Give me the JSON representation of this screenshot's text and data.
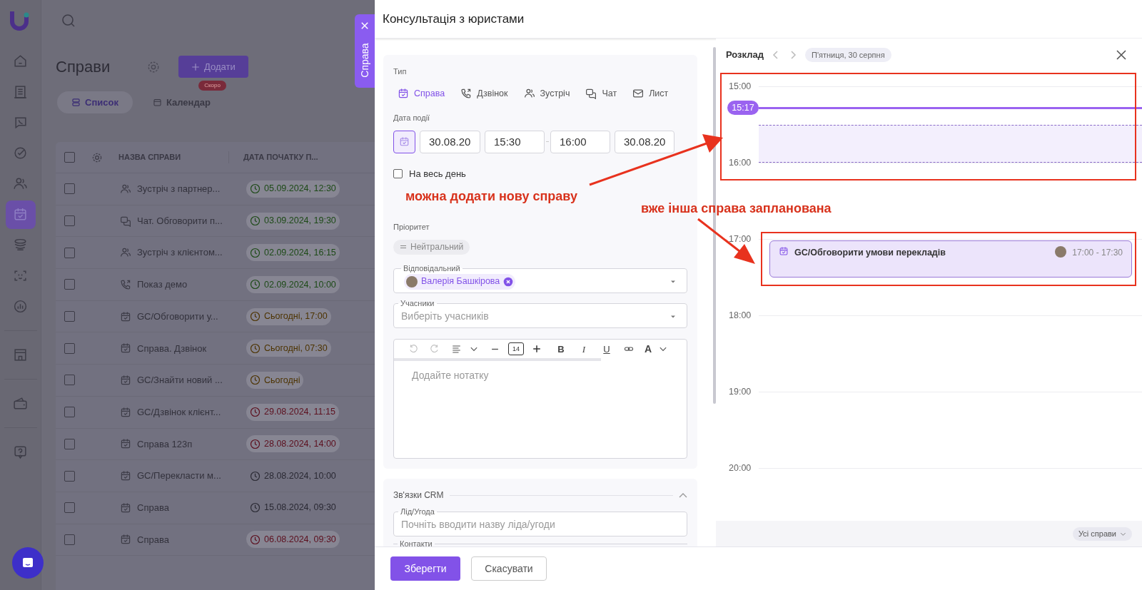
{
  "sidebar": {
    "groups": [
      [
        {
          "selected": false
        },
        {
          "selected": false
        },
        {
          "selected": false
        },
        {
          "selected": false
        },
        {
          "selected": false
        },
        {
          "selected": true
        },
        {
          "selected": false
        },
        {
          "selected": false
        },
        {
          "selected": false
        }
      ],
      [
        {
          "selected": false
        }
      ],
      [
        {
          "selected": false
        }
      ],
      [
        {
          "selected": false
        }
      ]
    ]
  },
  "page": {
    "title": "Справи",
    "add_button": "Додати",
    "view_tabs": [
      {
        "label": "Список",
        "selected": true
      },
      {
        "label": "Календар",
        "selected": false,
        "badge": "Скоро"
      }
    ]
  },
  "table": {
    "select_all": {
      "checked": false
    },
    "columns": [
      "НАЗВА СПРАВИ",
      "ДАТА ПОЧАТКУ П..."
    ],
    "rows": [
      {
        "checked": false,
        "kind": "meeting",
        "name": "Зустріч з партнер...",
        "date": "05.09.2024, 12:30",
        "color": "#1d4a17"
      },
      {
        "checked": false,
        "kind": "chat",
        "name": "Чат. Обговорити п...",
        "date": "03.09.2024, 19:30",
        "color": "#1d4a17"
      },
      {
        "checked": false,
        "kind": "meeting",
        "name": "Зустріч з клієнтом...",
        "date": "02.09.2024, 16:15",
        "color": "#1d4a17"
      },
      {
        "checked": false,
        "kind": "call",
        "name": "Показ демо",
        "date": "02.09.2024, 10:00",
        "color": "#1d4a17"
      },
      {
        "checked": false,
        "kind": "task",
        "name": "GC/Обговорити у...",
        "date": "Сьогодні, 17:00",
        "color": "#4d3300"
      },
      {
        "checked": false,
        "kind": "task",
        "name": "Справа. Дзвінок",
        "date": "Сьогодні, 07:30",
        "color": "#4d3300"
      },
      {
        "checked": false,
        "kind": "task",
        "name": "GC/Знайти новий ...",
        "date": "Сьогодні",
        "color": "#4d3300"
      },
      {
        "checked": false,
        "kind": "task",
        "name": "GC/Дзвінок клієнт...",
        "date": "29.08.2024, 11:15",
        "color": "#5c0f1e"
      },
      {
        "checked": false,
        "kind": "task",
        "name": "Справа 123п",
        "date": "28.08.2024, 14:00",
        "color": "#5c0f1e"
      },
      {
        "checked": false,
        "kind": "task",
        "name": "GC/Перекласти м...",
        "date": "28.08.2024, 10:00"
      },
      {
        "checked": false,
        "kind": "task",
        "name": "Справа",
        "date": "15.08.2024, 09:30"
      },
      {
        "checked": false,
        "kind": "task",
        "name": "Справа",
        "date": "06.08.2024, 09:30",
        "color": "#5c0f1e"
      }
    ]
  },
  "side_tab": {
    "label": "Справа"
  },
  "drawer": {
    "title": "Консультація з юристами",
    "type": {
      "label": "Тип",
      "options": [
        {
          "kind": "task",
          "label": "Справа",
          "selected": true
        },
        {
          "kind": "call",
          "label": "Дзвінок",
          "selected": false
        },
        {
          "kind": "meeting",
          "label": "Зустріч",
          "selected": false
        },
        {
          "kind": "chat",
          "label": "Чат",
          "selected": false
        },
        {
          "kind": "mail",
          "label": "Лист",
          "selected": false
        }
      ]
    },
    "date": {
      "label": "Дата події",
      "start_date": "30.08.20",
      "start_time": "15:30",
      "end_time": "16:00",
      "end_date": "30.08.20"
    },
    "all_day": {
      "label": "На весь день",
      "checked": false
    },
    "priority": {
      "label": "Пріоритет",
      "value": "Нейтральний"
    },
    "responsible": {
      "label": "Відповідальний",
      "value": "Валерія Башкірова"
    },
    "participants": {
      "label": "Учасники",
      "placeholder": "Виберіть учасників"
    },
    "editor": {
      "font_size": "14",
      "format_buttons": [
        "B",
        "I",
        "U"
      ],
      "color_button": "A",
      "placeholder": "Додайте нотатку"
    },
    "crm": {
      "title": "Зв'язки CRM",
      "expanded": true,
      "lead": {
        "label": "Лід/Угода",
        "placeholder": "Почніть вводити назву ліда/угоди"
      },
      "contacts": {
        "label": "Контакти"
      }
    },
    "buttons": {
      "save": "Зберегти",
      "cancel": "Скасувати"
    }
  },
  "schedule": {
    "title": "Розклад",
    "date": "П'ятниця, 30 серпня",
    "hours": [
      "15:00",
      "16:00",
      "17:00",
      "18:00",
      "19:00",
      "20:00"
    ],
    "now": "15:17",
    "event": {
      "title": "GC/Обговорити умови перекладів",
      "time": "17:00 - 17:30"
    },
    "filter": "Усі справи"
  },
  "annotations": [
    {
      "text": "можна додати нову справу"
    },
    {
      "text": "вже інша справа запланована"
    }
  ]
}
